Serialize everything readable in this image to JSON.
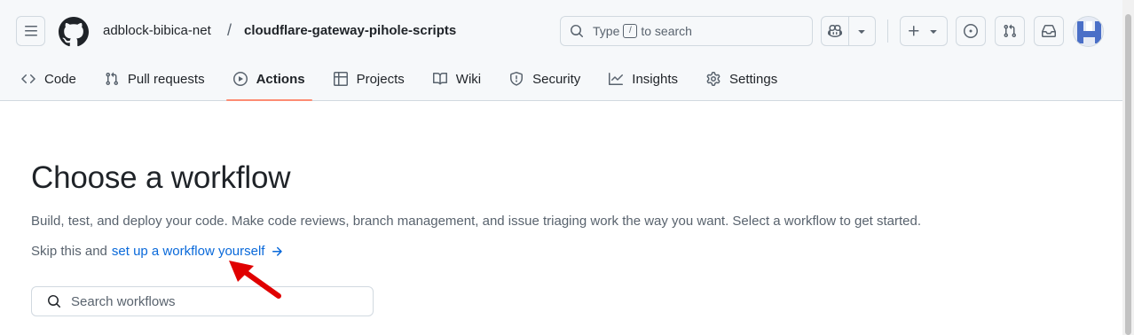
{
  "header": {
    "owner": "adblock-bibica-net",
    "separator": "/",
    "repo": "cloudflare-gateway-pihole-scripts",
    "search": {
      "prefix": "Type",
      "key": "/",
      "suffix": "to search"
    },
    "icons": {
      "menu": "hamburger-menu-icon",
      "logo": "github-logo-icon",
      "copilot": "copilot-icon",
      "plus": "plus-icon",
      "issues": "issue-opened-icon",
      "pulls": "git-pull-request-icon",
      "inbox": "inbox-icon"
    }
  },
  "tabs": [
    {
      "label": "Code",
      "icon": "code-icon"
    },
    {
      "label": "Pull requests",
      "icon": "git-pull-request-icon"
    },
    {
      "label": "Actions",
      "icon": "play-icon",
      "active": true
    },
    {
      "label": "Projects",
      "icon": "table-icon"
    },
    {
      "label": "Wiki",
      "icon": "book-icon"
    },
    {
      "label": "Security",
      "icon": "shield-icon"
    },
    {
      "label": "Insights",
      "icon": "graph-icon"
    },
    {
      "label": "Settings",
      "icon": "gear-icon"
    }
  ],
  "main": {
    "title": "Choose a workflow",
    "description": "Build, test, and deploy your code. Make code reviews, branch management, and issue triaging work the way you want. Select a workflow to get started.",
    "skip_prefix": "Skip this and",
    "skip_link": "set up a workflow yourself",
    "search_placeholder": "Search workflows"
  },
  "colors": {
    "accent": "#0969da",
    "tab_underline": "#fd8c73",
    "annotation_arrow": "#e00000"
  }
}
